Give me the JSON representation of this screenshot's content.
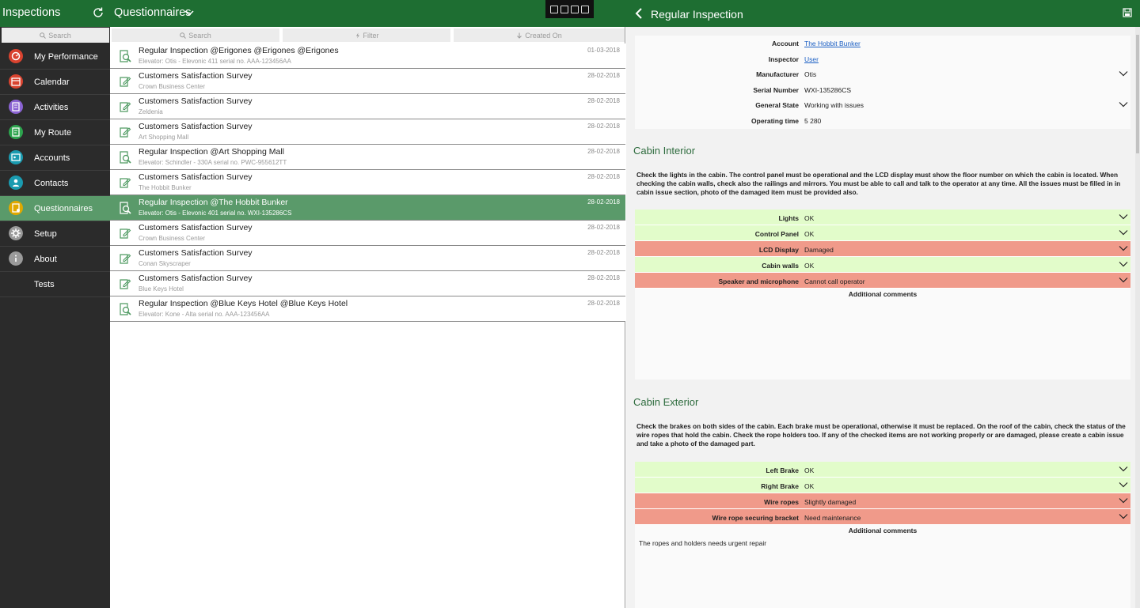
{
  "app": {
    "title": "Inspections",
    "section": "Questionnaires",
    "detail_title": "Regular Inspection",
    "accent": "#1e6e32",
    "selected_row_color": "#5a9a6a"
  },
  "sidebar": {
    "search_placeholder": "Search",
    "items": [
      {
        "label": "My Performance",
        "icon": "performance-icon",
        "color": "#d9432f"
      },
      {
        "label": "Calendar",
        "icon": "calendar-icon",
        "color": "#d9432f"
      },
      {
        "label": "Activities",
        "icon": "activities-icon",
        "color": "#8a63d2"
      },
      {
        "label": "My Route",
        "icon": "route-icon",
        "color": "#2da44e"
      },
      {
        "label": "Accounts",
        "icon": "accounts-icon",
        "color": "#1a9bb0"
      },
      {
        "label": "Contacts",
        "icon": "contacts-icon",
        "color": "#1a9bb0"
      },
      {
        "label": "Questionnaires",
        "icon": "questionnaires-icon",
        "color": "#e0a800"
      },
      {
        "label": "Setup",
        "icon": "gear-icon",
        "color": "#9a9a9a"
      },
      {
        "label": "About",
        "icon": "info-icon",
        "color": "#9a9a9a"
      },
      {
        "label": "Tests",
        "icon": "",
        "color": ""
      }
    ]
  },
  "list": {
    "search_label": "Search",
    "filter_label": "Filter",
    "sort_label": "Created On",
    "rows": [
      {
        "title": "Regular Inspection @Erigones @Erigones @Erigones",
        "subtitle": "Elevator: Otis - Elevonic 411 serial no. AAA-123456AA",
        "date": "01-03-2018",
        "type": "inspection"
      },
      {
        "title": "Customers Satisfaction Survey",
        "subtitle": "Crown Business Center",
        "date": "28-02-2018",
        "type": "survey"
      },
      {
        "title": "Customers Satisfaction Survey",
        "subtitle": "Zeldenia",
        "date": "28-02-2018",
        "type": "survey"
      },
      {
        "title": "Customers Satisfaction Survey",
        "subtitle": "Art Shopping Mall",
        "date": "28-02-2018",
        "type": "survey"
      },
      {
        "title": "Regular Inspection @Art Shopping Mall",
        "subtitle": "Elevator: Schindler - 330A serial no. PWC-955612TT",
        "date": "28-02-2018",
        "type": "inspection"
      },
      {
        "title": "Customers Satisfaction Survey",
        "subtitle": "The Hobbit Bunker",
        "date": "28-02-2018",
        "type": "survey"
      },
      {
        "title": "Regular Inspection @The Hobbit Bunker",
        "subtitle": "Elevator: Otis - Elevonic 401 serial no. WXI-135286CS",
        "date": "28-02-2018",
        "type": "inspection",
        "selected": true
      },
      {
        "title": "Customers Satisfaction Survey",
        "subtitle": "Crown Business Center",
        "date": "28-02-2018",
        "type": "survey"
      },
      {
        "title": "Customers Satisfaction Survey",
        "subtitle": "Conan Skyscraper",
        "date": "28-02-2018",
        "type": "survey"
      },
      {
        "title": "Customers Satisfaction Survey",
        "subtitle": "Blue Keys Hotel",
        "date": "28-02-2018",
        "type": "survey"
      },
      {
        "title": "Regular Inspection @Blue Keys Hotel @Blue Keys Hotel",
        "subtitle": "Elevator: Kone - Alta serial no. AAA-123456AA",
        "date": "28-02-2018",
        "type": "inspection"
      }
    ]
  },
  "detail": {
    "info": [
      {
        "label": "Account",
        "value": "The Hobbit Bunker",
        "link": true,
        "dropdown": false
      },
      {
        "label": "Inspector",
        "value": "User",
        "link": true,
        "dropdown": false
      },
      {
        "label": "Manufacturer",
        "value": "Otis",
        "link": false,
        "dropdown": true
      },
      {
        "label": "Serial Number",
        "value": "WXI-135286CS",
        "link": false,
        "dropdown": false
      },
      {
        "label": "General State",
        "value": "Working with issues",
        "link": false,
        "dropdown": true
      },
      {
        "label": "Operating time",
        "value": "5 280",
        "link": false,
        "dropdown": false
      }
    ],
    "sections": [
      {
        "title": "Cabin Interior",
        "description": "Check the lights in the cabin. The control panel must be operational and the LCD display must show the floor number on which the cabin is located. When checking the cabin walls, check also the railings and mirrors. You must be able to call and talk to the operator at any time. All the issues must be filled in in cabin issue section, photo of the damaged item must be provided also.",
        "questions": [
          {
            "label": "Lights",
            "value": "OK",
            "status": "ok"
          },
          {
            "label": "Control Panel",
            "value": "OK",
            "status": "ok"
          },
          {
            "label": "LCD Display",
            "value": "Damaged",
            "status": "bad"
          },
          {
            "label": "Cabin walls",
            "value": "OK",
            "status": "ok"
          },
          {
            "label": "Speaker and microphone",
            "value": "Cannot call operator",
            "status": "bad"
          }
        ],
        "comments_label": "Additional comments",
        "comments": ""
      },
      {
        "title": "Cabin Exterior",
        "description": "Check the brakes on both sides of the cabin. Each brake must be operational, otherwise it must be replaced. On the roof of the cabin, check the status of the wire ropes that hold the cabin. Check the rope holders too. If any of the checked items are not working properly or are damaged, please create a cabin issue and take a photo of the damaged part.",
        "questions": [
          {
            "label": "Left Brake",
            "value": "OK",
            "status": "ok"
          },
          {
            "label": "Right Brake",
            "value": "OK",
            "status": "ok"
          },
          {
            "label": "Wire ropes",
            "value": "Slightly damaged",
            "status": "bad"
          },
          {
            "label": "Wire rope securing bracket",
            "value": "Need maintenance",
            "status": "bad"
          }
        ],
        "comments_label": "Additional comments",
        "comments": "The ropes and holders needs urgent repair"
      }
    ]
  }
}
